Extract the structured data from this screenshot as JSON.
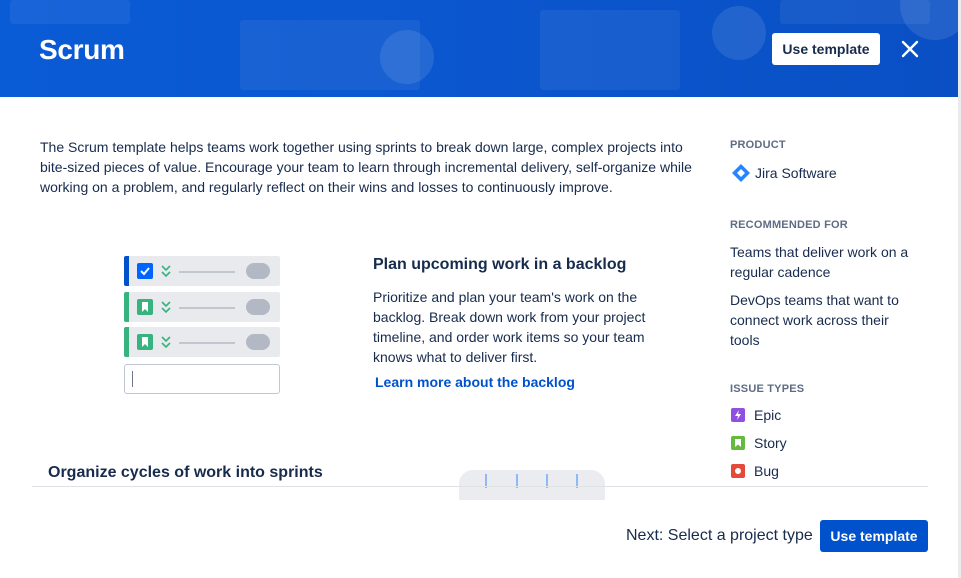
{
  "header": {
    "title": "Scrum",
    "use_template_label": "Use template",
    "close_icon": "close-icon",
    "gradient_color": "#0b57cf"
  },
  "description": "The Scrum template helps teams work together using sprints to break down large, complex projects into bite-sized pieces of value. Encourage your team to learn through incremental delivery, self-organize while working on a problem, and regularly reflect on their wins and losses to continuously improve.",
  "feature": {
    "title": "Plan upcoming work in a backlog",
    "text": "Prioritize and plan your team's work on the backlog. Break down work from your project timeline, and order work items so your team knows what to deliver first.",
    "link": "Learn more about the backlog"
  },
  "section2_title": "Organize cycles of work into sprints",
  "sidebar": {
    "product_label": "PRODUCT",
    "product_name": "Jira Software",
    "recommended_label": "RECOMMENDED FOR",
    "recommended": [
      "Teams that deliver work on a regular cadence",
      "DevOps teams that want to connect work across their tools"
    ],
    "issue_types_label": "ISSUE TYPES",
    "issue_types": [
      {
        "name": "Epic",
        "color": "#904ee2",
        "icon": "lightning-icon"
      },
      {
        "name": "Story",
        "color": "#63ba3c",
        "icon": "bookmark-icon"
      },
      {
        "name": "Bug",
        "color": "#e5493a",
        "icon": "bug-icon"
      }
    ]
  },
  "footer": {
    "next_text": "Next: Select a project type",
    "use_template_label": "Use template",
    "button_color": "#0052cc"
  }
}
